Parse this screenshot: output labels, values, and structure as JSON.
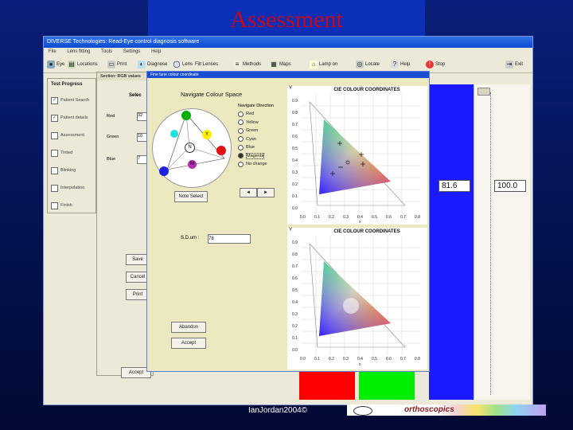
{
  "slide": {
    "title": "Assessment",
    "footer": "IanJordan2004©",
    "logo_text": "orthoscopics"
  },
  "app": {
    "title": "DIVERSE Technologies: Read-Eye control diagnosis software",
    "menu": [
      "File",
      "Lens fitting",
      "Tools",
      "Settings",
      "Help"
    ],
    "toolbar": [
      "Eye",
      "Locations",
      "Print",
      "Diagnose",
      "Lens",
      "Filt Lenses",
      "Methods",
      "Maps",
      "Lamp on",
      "Locate",
      "Help",
      "Stop",
      "Exit"
    ],
    "left_panel": {
      "heading": "Test Progress",
      "items": [
        {
          "label": "Patient Search",
          "checked": true
        },
        {
          "label": "Patient details",
          "checked": true
        },
        {
          "label": "Assessment",
          "checked": false
        },
        {
          "label": "Tinted",
          "checked": false
        },
        {
          "label": "Blinking",
          "checked": false
        },
        {
          "label": "Interpolation",
          "checked": false
        },
        {
          "label": "Finish",
          "checked": false
        }
      ]
    },
    "select_panel": {
      "header": "Section: RGB values",
      "select_label": "Selec",
      "red_label": "Red",
      "green_label": "Green",
      "blue_label": "Blue",
      "red_value": "32",
      "green_value": "10",
      "blue_value": "7",
      "buttons": [
        "Save",
        "Cancel",
        "Print",
        "Accept"
      ]
    },
    "right_values": {
      "left_value": "81.6",
      "right_value": "100.0"
    }
  },
  "dialog": {
    "title": "Fine tune colour coordinate",
    "nav_title": "Navigate Colour Space",
    "direction_heading": "Navigate Direction",
    "directions": [
      "Red",
      "Yellow",
      "Green",
      "Cyan",
      "Blue",
      "Magenta",
      "No change"
    ],
    "selected_direction": "Magenta",
    "wheel_center_label": "N",
    "wheel_yellow_label": "Y",
    "wheel_magenta_label": "M",
    "note_button": "Note Select",
    "sd_label": "S.D.um :",
    "sd_value": "78",
    "buttons": [
      "Abandon",
      "Accept"
    ],
    "arrows": [
      "◄",
      "►"
    ]
  },
  "cie_top": {
    "title": "CIE COLOUR COORDINATES",
    "ylabel": "Y",
    "xlabel": "x",
    "yticks": [
      "0.9",
      "0.8",
      "0.7",
      "0.6",
      "0.5",
      "0.4",
      "0.3",
      "0.2",
      "0.1",
      "0.0"
    ],
    "xticks": [
      "0.0",
      "0.1",
      "0.2",
      "0.3",
      "0.4",
      "0.5",
      "0.6",
      "0.7",
      "0.8"
    ]
  },
  "cie_bottom": {
    "title": "CIE COLOUR COORDINATES",
    "ylabel": "Y",
    "xlabel": "x",
    "yticks": [
      "0.9",
      "0.8",
      "0.7",
      "0.6",
      "0.5",
      "0.4",
      "0.3",
      "0.2",
      "0.1",
      "0.0"
    ],
    "xticks": [
      "0.0",
      "0.1",
      "0.2",
      "0.3",
      "0.4",
      "0.5",
      "0.6",
      "0.7",
      "0.8"
    ]
  },
  "colors": {
    "title_red": "#c8081a",
    "bar_blue": "#1a1aff",
    "bar_red": "#ff0000",
    "bar_green": "#00ee00"
  }
}
